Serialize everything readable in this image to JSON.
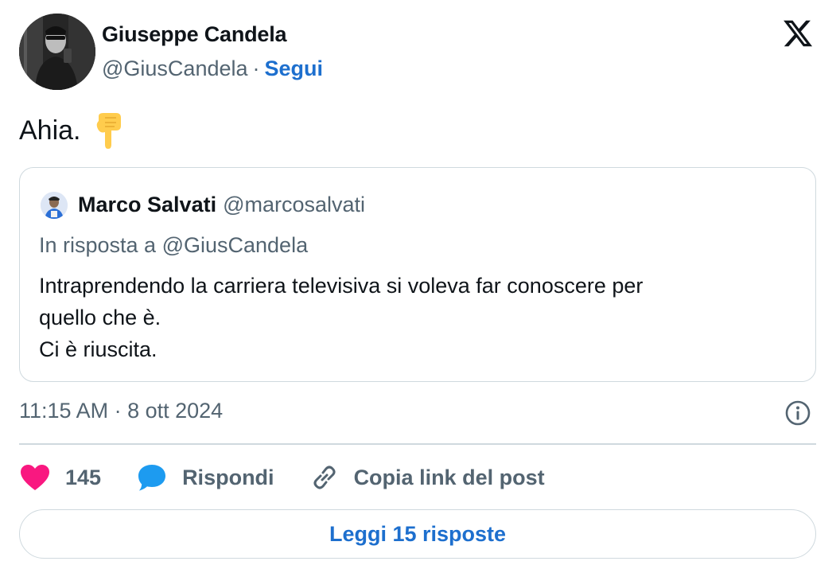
{
  "author": {
    "name": "Giuseppe Candela",
    "handle": "@GiusCandela",
    "separator": "·",
    "follow_label": "Segui"
  },
  "tweet": {
    "text": "Ahia.",
    "emoji": "👇"
  },
  "quoted": {
    "name": "Marco Salvati",
    "handle": "@marcosalvati",
    "reply_to": "In risposta a @GiusCandela",
    "lines": [
      "Intraprendendo la carriera televisiva si voleva far conoscere per",
      "quello che è.",
      "Ci è riuscita."
    ]
  },
  "meta": {
    "timestamp": "11:15 AM · 8 ott 2024"
  },
  "actions": {
    "like_count": "145",
    "reply_label": "Rispondi",
    "copy_link_label": "Copia link del post"
  },
  "footer": {
    "read_replies_label": "Leggi 15 risposte"
  },
  "icons": {
    "platform": "x-logo-icon",
    "info": "info-icon",
    "like": "heart-icon",
    "reply": "speech-bubble-icon",
    "link": "link-icon"
  },
  "colors": {
    "link_blue": "#1d6fce",
    "heart": "#f91880",
    "bubble": "#1d9bf0",
    "muted": "#536471",
    "border": "#cfd9de"
  }
}
